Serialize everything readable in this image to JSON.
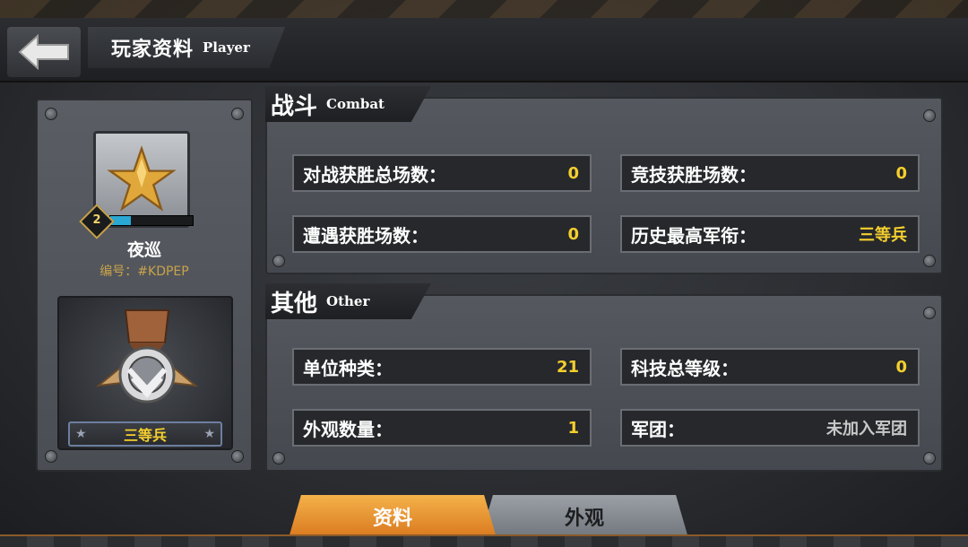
{
  "header": {
    "title_cn": "玩家资料",
    "title_en": "Player"
  },
  "player": {
    "level": "2",
    "level_progress": 0.25,
    "name": "夜巡",
    "id": "编号：#KDPEP",
    "rank": "三等兵"
  },
  "combat": {
    "title_cn": "战斗",
    "title_en": "Combat",
    "stats": [
      {
        "label": "对战获胜总场数：",
        "value": "0"
      },
      {
        "label": "竞技获胜场数：",
        "value": "0"
      },
      {
        "label": "遭遇获胜场数：",
        "value": "0"
      },
      {
        "label": "历史最高军衔：",
        "value": "三等兵"
      }
    ]
  },
  "other": {
    "title_cn": "其他",
    "title_en": "Other",
    "stats": [
      {
        "label": "单位种类：",
        "value": "21"
      },
      {
        "label": "科技总等级：",
        "value": "0"
      },
      {
        "label": "外观数量：",
        "value": "1"
      },
      {
        "label": "军团：",
        "value": "未加入军团"
      }
    ]
  },
  "tabs": {
    "profile": "资料",
    "appearance": "外观"
  },
  "colors": {
    "value_yellow": "#f5cf2e",
    "tab_active": "#e8962e",
    "tab_inactive": "#868c92",
    "level_bar": "#2aa8d4"
  },
  "icons": {
    "back": "back-arrow-icon",
    "rank": "gold-star-icon",
    "medal": "medal-icon"
  }
}
